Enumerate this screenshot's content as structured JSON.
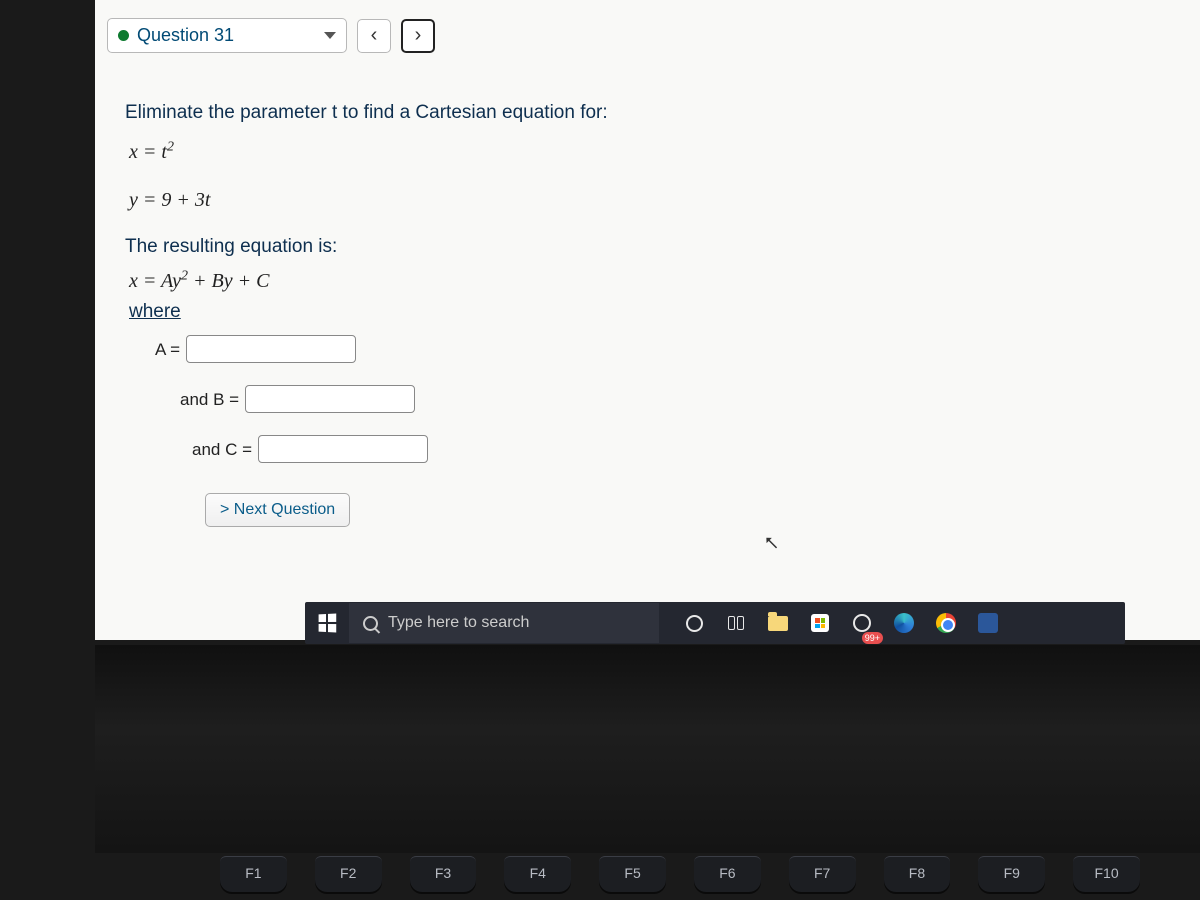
{
  "question": {
    "selector_label": "Question 31",
    "prompt": "Eliminate the parameter t to find a Cartesian equation for:",
    "eq1_lhs": "x",
    "eq1_rhs": "t",
    "eq1_exp": "2",
    "eq2_lhs": "y",
    "eq2_rhs": "9 + 3t",
    "result_intro": "The resulting equation is:",
    "result_eq_lhs": "x",
    "result_eq_rhs_A": "Ay",
    "result_eq_exp": "2",
    "result_eq_rest": " + By + C",
    "where": "where",
    "label_A": "A =",
    "label_B": "and B =",
    "label_C": "and C =",
    "value_A": "",
    "value_B": "",
    "value_C": "",
    "next_button": "> Next Question"
  },
  "taskbar": {
    "search_placeholder": "Type here to search",
    "mail_badge": "99+"
  },
  "keyboard": {
    "keys": [
      "F1",
      "F2",
      "F3",
      "F4",
      "F5",
      "F6",
      "F7",
      "F8",
      "F9",
      "F10"
    ]
  }
}
